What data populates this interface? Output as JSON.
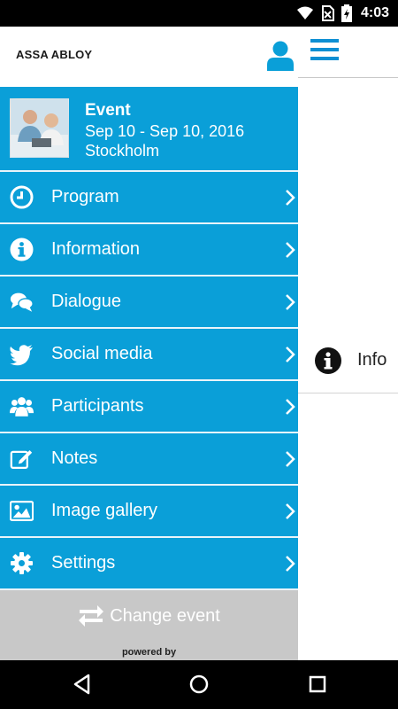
{
  "status_bar": {
    "time": "4:03"
  },
  "brand": {
    "logo_text": "ASSA ABLOY",
    "accent": "#0a9fd8"
  },
  "event": {
    "title": "Event",
    "dates": "Sep 10 - Sep 10, 2016",
    "location": "Stockholm"
  },
  "menu": {
    "items": [
      {
        "label": "Program",
        "icon": "clock-icon"
      },
      {
        "label": "Information",
        "icon": "info-icon"
      },
      {
        "label": "Dialogue",
        "icon": "chat-bubbles-icon"
      },
      {
        "label": "Social media",
        "icon": "twitter-bird-icon"
      },
      {
        "label": "Participants",
        "icon": "people-group-icon"
      },
      {
        "label": "Notes",
        "icon": "edit-note-icon"
      },
      {
        "label": "Image gallery",
        "icon": "image-icon"
      },
      {
        "label": "Settings",
        "icon": "gear-icon"
      }
    ],
    "change_event_label": "Change event",
    "powered_by": "powered by"
  },
  "background_page": {
    "row_label": "Info"
  }
}
